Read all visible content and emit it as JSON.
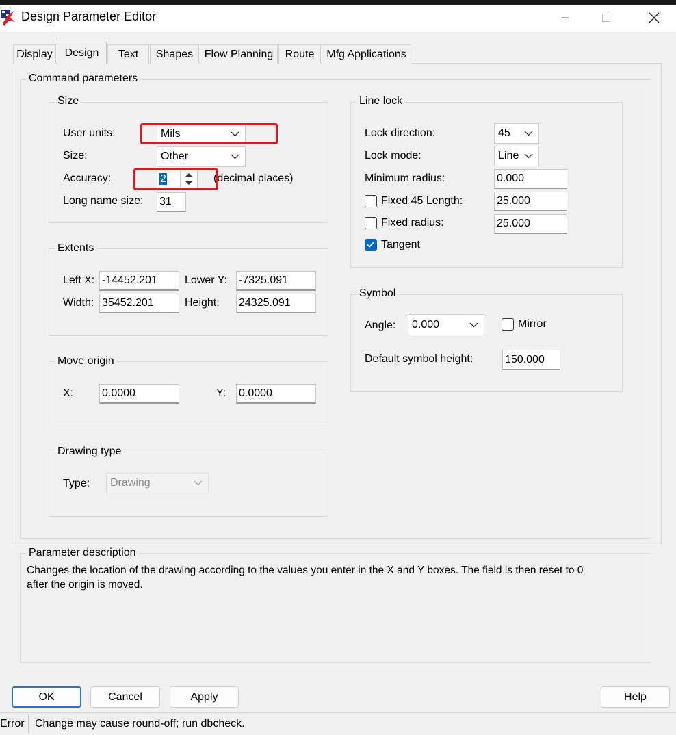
{
  "window": {
    "title": "Design Parameter Editor"
  },
  "tabs": [
    {
      "label": "Display"
    },
    {
      "label": "Design"
    },
    {
      "label": "Text"
    },
    {
      "label": "Shapes"
    },
    {
      "label": "Flow Planning"
    },
    {
      "label": "Route"
    },
    {
      "label": "Mfg Applications"
    }
  ],
  "active_tab": "Design",
  "command_parameters": {
    "legend": "Command parameters"
  },
  "size": {
    "legend": "Size",
    "user_units_label": "User units:",
    "user_units_value": "Mils",
    "size_label": "Size:",
    "size_value": "Other",
    "accuracy_label": "Accuracy:",
    "accuracy_value": "2",
    "accuracy_suffix": "(decimal places)",
    "long_name_label": "Long name size:",
    "long_name_value": "31"
  },
  "extents": {
    "legend": "Extents",
    "left_x_label": "Left X:",
    "left_x_value": "-14452.201",
    "lower_y_label": "Lower Y:",
    "lower_y_value": "-7325.091",
    "width_label": "Width:",
    "width_value": "35452.201",
    "height_label": "Height:",
    "height_value": "24325.091"
  },
  "move_origin": {
    "legend": "Move origin",
    "x_label": "X:",
    "x_value": "0.0000",
    "y_label": "Y:",
    "y_value": "0.0000"
  },
  "drawing_type": {
    "legend": "Drawing type",
    "type_label": "Type:",
    "type_value": "Drawing"
  },
  "line_lock": {
    "legend": "Line lock",
    "lock_direction_label": "Lock direction:",
    "lock_direction_value": "45",
    "lock_mode_label": "Lock mode:",
    "lock_mode_value": "Line",
    "min_radius_label": "Minimum radius:",
    "min_radius_value": "0.000",
    "fixed45_label": "Fixed 45 Length:",
    "fixed45_checked": false,
    "fixed45_value": "25.000",
    "fixed_radius_label": "Fixed radius:",
    "fixed_radius_checked": false,
    "fixed_radius_value": "25.000",
    "tangent_label": "Tangent",
    "tangent_checked": true
  },
  "symbol": {
    "legend": "Symbol",
    "angle_label": "Angle:",
    "angle_value": "0.000",
    "mirror_label": "Mirror",
    "mirror_checked": false,
    "default_height_label": "Default symbol height:",
    "default_height_value": "150.000"
  },
  "parameter_description": {
    "legend": "Parameter description",
    "line1": "Changes the location of the drawing according to the values you enter in the X and Y boxes. The field is then reset to 0",
    "line2": "after the origin is moved."
  },
  "buttons": {
    "ok": "OK",
    "cancel": "Cancel",
    "apply": "Apply",
    "help": "Help"
  },
  "status": {
    "label": "Error",
    "message": "Change may cause round-off; run dbcheck."
  },
  "colors": {
    "highlight": "#e8141b",
    "accent": "#0067c0",
    "selection": "#0067c0"
  }
}
